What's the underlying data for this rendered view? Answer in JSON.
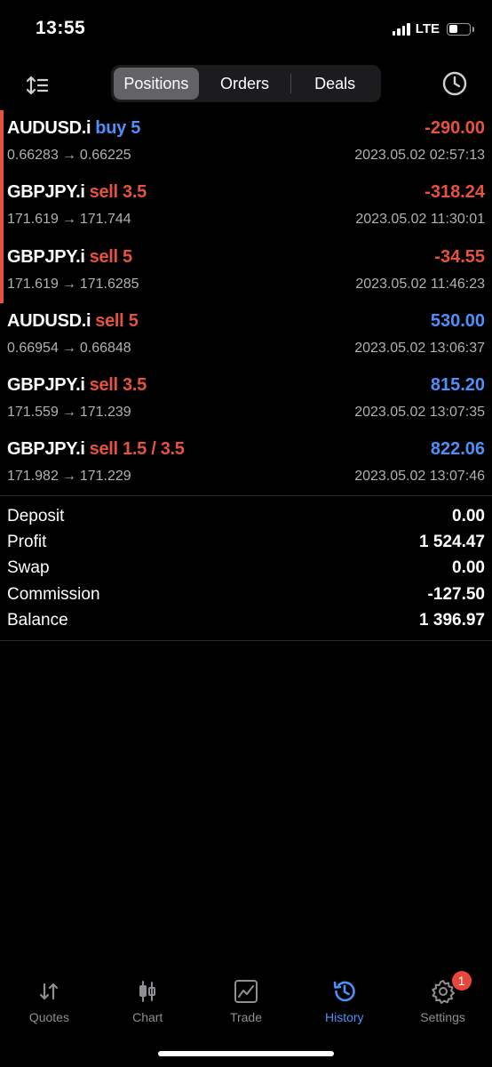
{
  "status_bar": {
    "time": "13:55",
    "network": "LTE"
  },
  "header": {
    "segments": [
      {
        "label": "Positions",
        "active": true
      },
      {
        "label": "Orders",
        "active": false
      },
      {
        "label": "Deals",
        "active": false
      }
    ],
    "sort_icon": "sort-icon",
    "clock_icon": "clock-icon"
  },
  "positions": [
    {
      "symbol": "AUDUSD.i",
      "side": "buy",
      "volume": "buy 5",
      "prices": "0.66283 → 0.66225",
      "open_price": "0.66283",
      "close_price": "0.66225",
      "profit": "-290.00",
      "time": "2023.05.02 02:57:13"
    },
    {
      "symbol": "GBPJPY.i",
      "side": "sell",
      "volume": "sell 3.5",
      "open_price": "171.619",
      "close_price": "171.744",
      "profit": "-318.24",
      "time": "2023.05.02 11:30:01"
    },
    {
      "symbol": "GBPJPY.i",
      "side": "sell",
      "volume": "sell 5",
      "open_price": "171.619",
      "close_price": "171.6285",
      "profit": "-34.55",
      "time": "2023.05.02 11:46:23"
    },
    {
      "symbol": "AUDUSD.i",
      "side": "sell",
      "volume": "sell 5",
      "open_price": "0.66954",
      "close_price": "0.66848",
      "profit": "530.00",
      "time": "2023.05.02 13:06:37"
    },
    {
      "symbol": "GBPJPY.i",
      "side": "sell",
      "volume": "sell 3.5",
      "open_price": "171.559",
      "close_price": "171.239",
      "profit": "815.20",
      "time": "2023.05.02 13:07:35"
    },
    {
      "symbol": "GBPJPY.i",
      "side": "sell",
      "volume": "sell 1.5 / 3.5",
      "open_price": "171.982",
      "close_price": "171.229",
      "profit": "822.06",
      "time": "2023.05.02 13:07:46"
    }
  ],
  "arrow": "→",
  "summary": [
    {
      "label": "Deposit",
      "value": "0.00"
    },
    {
      "label": "Profit",
      "value": "1 524.47"
    },
    {
      "label": "Swap",
      "value": "0.00"
    },
    {
      "label": "Commission",
      "value": "-127.50"
    },
    {
      "label": "Balance",
      "value": "1 396.97"
    }
  ],
  "tabs": [
    {
      "label": "Quotes",
      "icon": "quotes-icon",
      "active": false
    },
    {
      "label": "Chart",
      "icon": "chart-icon",
      "active": false
    },
    {
      "label": "Trade",
      "icon": "trade-icon",
      "active": false
    },
    {
      "label": "History",
      "icon": "history-icon",
      "active": true
    },
    {
      "label": "Settings",
      "icon": "settings-icon",
      "active": false,
      "badge": "1"
    }
  ],
  "colors": {
    "loss": "#e5533f",
    "profit": "#4e8ff8",
    "accent": "#4e8ff8",
    "badge": "#e8453c"
  }
}
